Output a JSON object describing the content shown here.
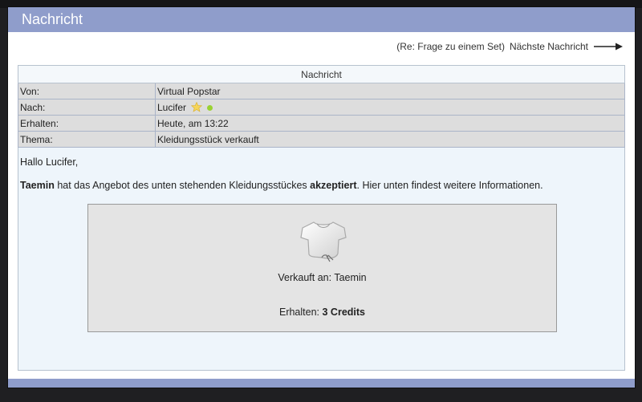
{
  "window": {
    "title": "Nachricht"
  },
  "next_link": {
    "subject": "(Re: Frage zu einem Set)",
    "label": "Nächste Nachricht"
  },
  "message": {
    "header": "Nachricht",
    "fields": [
      {
        "label": "Von:",
        "value": "Virtual Popstar"
      },
      {
        "label": "Nach:",
        "value": "Lucifer"
      },
      {
        "label": "Erhalten:",
        "value": "Heute, am 13:22"
      },
      {
        "label": "Thema:",
        "value": "Kleidungsstück verkauft"
      }
    ],
    "recipient_badges": [
      "star-icon",
      "online-dot"
    ],
    "greeting": "Hallo Lucifer,",
    "body": {
      "buyer": "Taemin",
      "text1": " hat das Angebot des unten stehenden Kleidungsstückes ",
      "status": "akzeptiert",
      "text2": ". Hier unten findest weitere Informationen."
    },
    "item": {
      "icon": "shirt-icon",
      "sold_to_label": "Verkauft an:",
      "sold_to_value": "Taemin",
      "received_label": "Erhalten:",
      "received_value": "3 Credits"
    }
  },
  "colors": {
    "title_bar": "#8f9dcb",
    "message_bg": "#eef5fb",
    "field_bg": "#dddddd",
    "online": "#9ad232"
  }
}
